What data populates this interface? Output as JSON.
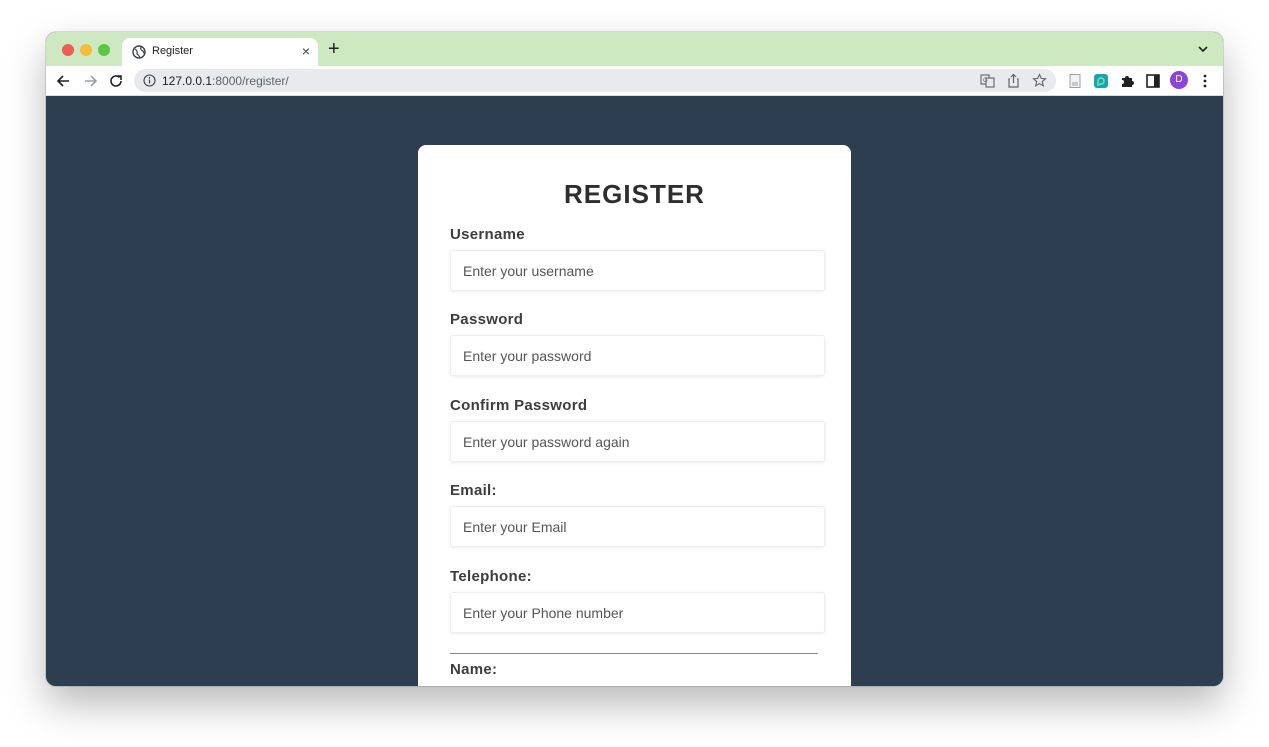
{
  "browser": {
    "tab_title": "Register",
    "tab_close": "×",
    "new_tab": "+",
    "url_host": "127.0.0.1",
    "url_rest": ":8000/register/",
    "profile_initial": "D"
  },
  "form": {
    "title": "REGISTER",
    "fields": [
      {
        "label": "Username",
        "placeholder": "Enter your username"
      },
      {
        "label": "Password",
        "placeholder": "Enter your password"
      },
      {
        "label": "Confirm Password",
        "placeholder": "Enter your password again"
      },
      {
        "label": "Email:",
        "placeholder": "Enter your Email"
      },
      {
        "label": "Telephone:",
        "placeholder": "Enter your Phone number"
      }
    ],
    "name_label": "Name:"
  },
  "icons": [
    "globe-icon",
    "close-icon",
    "plus-icon",
    "chevron-down-icon",
    "back-arrow-icon",
    "forward-arrow-icon",
    "reload-icon",
    "info-icon",
    "translate-icon",
    "share-icon",
    "star-icon",
    "reader-icon",
    "extension-teal-icon",
    "puzzle-icon",
    "sidepanel-icon",
    "profile-avatar",
    "kebab-menu-icon"
  ],
  "colors": {
    "tab_strip": "#cde9c2",
    "page_background": "#2d3e50",
    "card": "#ffffff",
    "profile": "#8e44d6"
  }
}
